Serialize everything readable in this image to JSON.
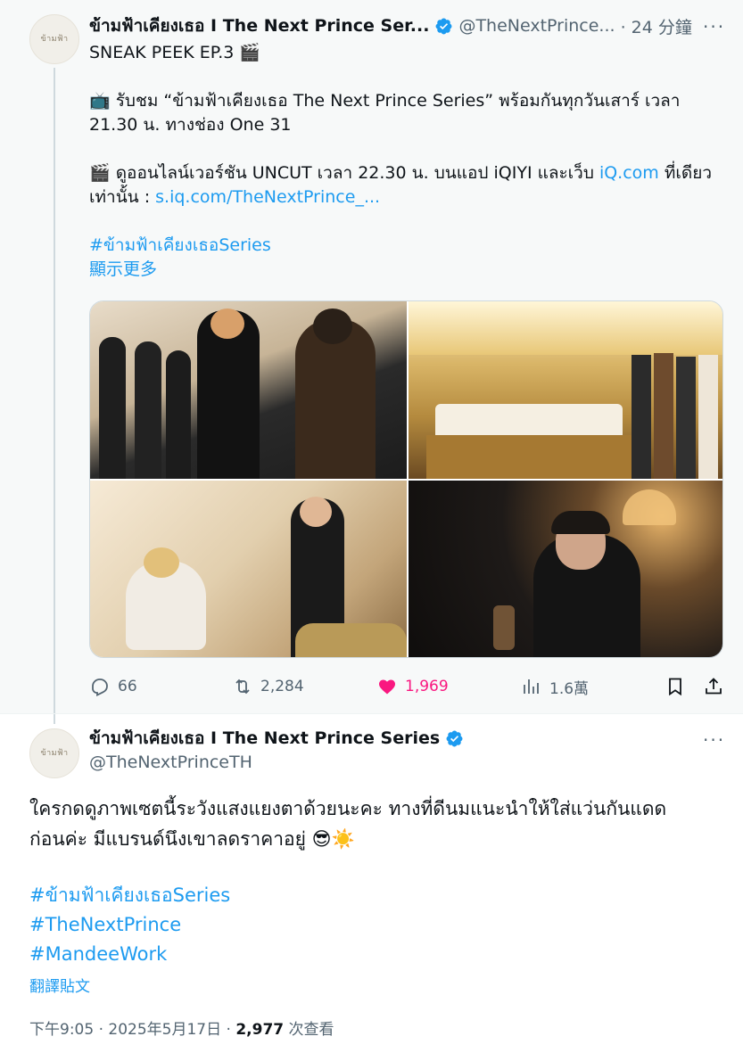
{
  "quoted_tweet": {
    "author_name": "ข้ามฟ้าเคียงเธอ I The Next Prince Ser...",
    "handle": "@TheNextPrince...",
    "time": "· 24 分鐘",
    "more": "···",
    "line1": "SNEAK PEEK EP.3 🎬",
    "line2": "📺 รับชม “ข้ามฟ้าเคียงเธอ The Next Prince Series” พร้อมกันทุกวันเสาร์ เวลา",
    "line3": "21.30 น. ทางช่อง One 31",
    "line4_prefix": "🎬 ดูออนไลน์เวอร์ชัน UNCUT เวลา 22.30 น. บนแอป iQIYI และเว็บ ",
    "line4_link": "iQ.com",
    "line4_suffix": " ที่เดียว",
    "line5_prefix": "เท่านั้น : ",
    "line5_link": "s.iq.com/TheNextPrince_...",
    "hashtag": "#ข้ามฟ้าเคียงเธอSeries",
    "show_more": "顯示更多",
    "actions": {
      "reply_count": "66",
      "retweet_count": "2,284",
      "like_count": "1,969",
      "views_count": "1.6萬"
    },
    "avatar_logo": "ข้ามฟ้า"
  },
  "main_tweet": {
    "author_name": "ข้ามฟ้าเคียงเธอ I The Next Prince Series",
    "handle": "@TheNextPrinceTH",
    "more": "···",
    "line1": "ใครกดดูภาพเซตนี้ระวังแสงแยงตาด้วยนะคะ ทางที่ดีนมแนะนำให้ใส่แว่นกันแดด",
    "line2": "ก่อนค่ะ มีแบรนด์นึงเขาลดราคาอยู่ 😎☀️",
    "hashtags": [
      "#ข้ามฟ้าเคียงเธอSeries",
      "#TheNextPrince",
      "#MandeeWork"
    ],
    "translate": "翻譯貼文",
    "time": "下午9:05 · 2025年5月17日",
    "separator": " · ",
    "views_count": "2,977",
    "views_label": " 次查看",
    "avatar_logo": "ข้ามฟ้า"
  },
  "colors": {
    "link": "#1d9bf0",
    "like": "#f91880",
    "muted": "#536471",
    "quoted_bg": "#f7f9f9"
  }
}
